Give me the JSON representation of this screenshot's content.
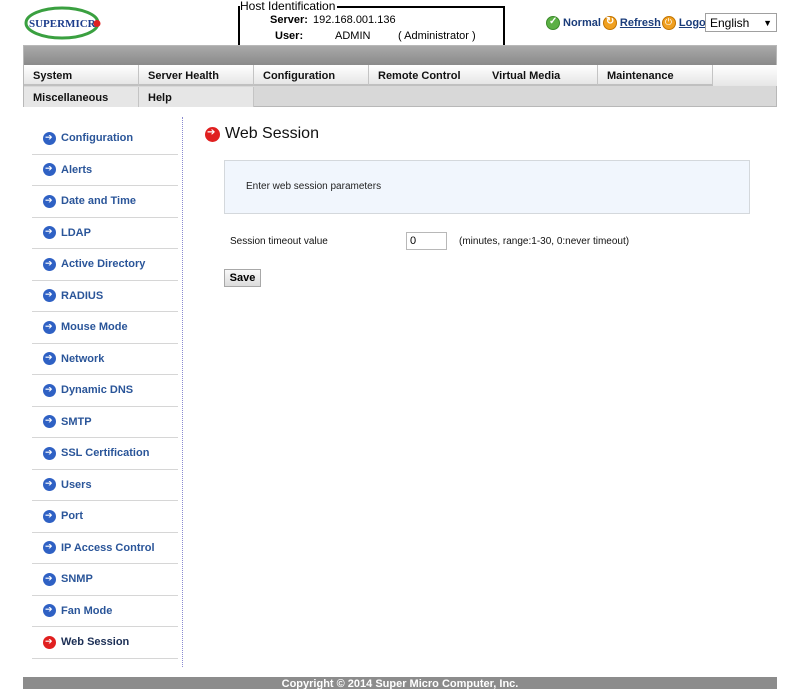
{
  "header": {
    "logo_text": "SUPERMICR",
    "host_identification": {
      "legend": "Host Identification",
      "server_label": "Server:",
      "server_value": "192.168.001.136",
      "user_label": "User:",
      "user_value": "ADMIN",
      "user_role": "( Administrator )"
    },
    "status_label": "Normal",
    "refresh_label": "Refresh",
    "logout_label": "Logout",
    "language": "English"
  },
  "nav": {
    "row1": [
      "System",
      "Server Health",
      "Configuration",
      "Remote Control",
      "Virtual Media",
      "Maintenance"
    ],
    "row2": [
      "Miscellaneous",
      "Help"
    ]
  },
  "sidebar": {
    "items": [
      {
        "label": "Configuration",
        "active": false
      },
      {
        "label": "Alerts",
        "active": false
      },
      {
        "label": "Date and Time",
        "active": false
      },
      {
        "label": "LDAP",
        "active": false
      },
      {
        "label": "Active Directory",
        "active": false
      },
      {
        "label": "RADIUS",
        "active": false
      },
      {
        "label": "Mouse Mode",
        "active": false
      },
      {
        "label": "Network",
        "active": false
      },
      {
        "label": "Dynamic DNS",
        "active": false
      },
      {
        "label": "SMTP",
        "active": false
      },
      {
        "label": "SSL Certification",
        "active": false
      },
      {
        "label": "Users",
        "active": false
      },
      {
        "label": "Port",
        "active": false
      },
      {
        "label": "IP Access Control",
        "active": false
      },
      {
        "label": "SNMP",
        "active": false
      },
      {
        "label": "Fan Mode",
        "active": false
      },
      {
        "label": "Web Session",
        "active": true
      }
    ]
  },
  "main": {
    "title": "Web Session",
    "info_text": "Enter web session parameters",
    "timeout_label": "Session timeout value",
    "timeout_value": "0",
    "timeout_hint": "(minutes, range:1-30, 0:never timeout)",
    "save_label": "Save"
  },
  "footer": {
    "copyright": "Copyright © 2014 Super Micro Computer, Inc."
  },
  "colors": {
    "link_blue": "#2a5599",
    "active_red": "#e02020",
    "nav_gray": "#8c8c8c",
    "info_bg": "#f1f6fd"
  }
}
